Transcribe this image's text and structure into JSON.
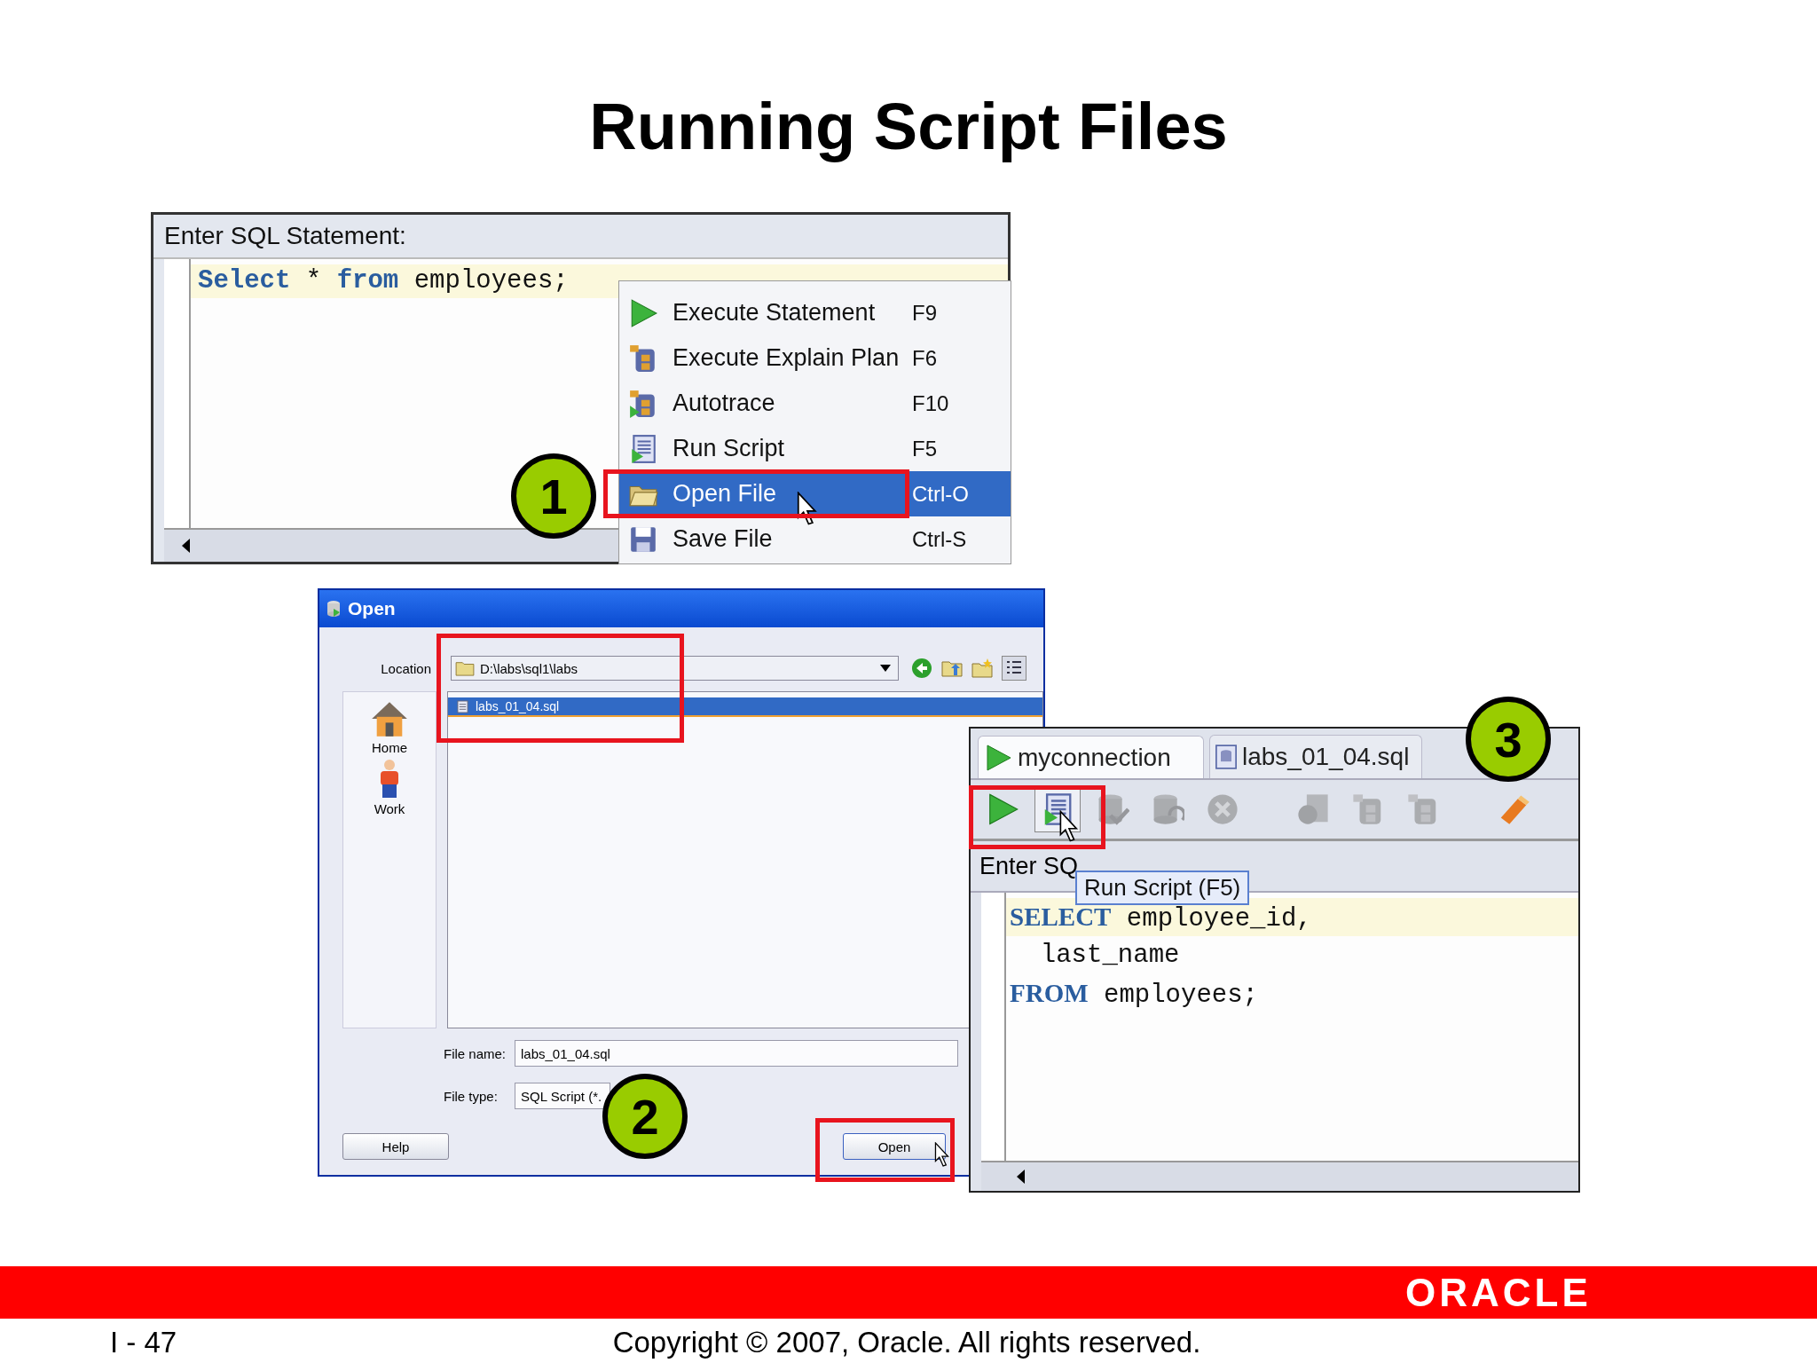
{
  "title": "Running Script Files",
  "worksheet_1": {
    "label": "Enter SQL Statement:",
    "code": [
      [
        {
          "kind": "keyword",
          "text": "Select"
        },
        {
          "kind": "plain",
          "text": " * "
        },
        {
          "kind": "keyword",
          "text": "from"
        },
        {
          "kind": "plain",
          "text": " employees;"
        }
      ]
    ],
    "context_menu": [
      {
        "kind": "execute",
        "label": "Execute Statement",
        "shortcut": "F9",
        "selected": false
      },
      {
        "kind": "explain",
        "label": "Execute Explain Plan",
        "shortcut": "F6",
        "selected": false
      },
      {
        "kind": "autotrace",
        "label": "Autotrace",
        "shortcut": "F10",
        "selected": false
      },
      {
        "kind": "run_script",
        "label": "Run Script",
        "shortcut": "F5",
        "selected": false
      },
      {
        "kind": "open",
        "label": "Open File",
        "shortcut": "Ctrl-O",
        "selected": true
      },
      {
        "kind": "save",
        "label": "Save File",
        "shortcut": "Ctrl-S",
        "selected": false
      }
    ]
  },
  "open_dialog": {
    "title": "Open",
    "location_label": "Location",
    "location": "D:\\labs\\sql1\\labs",
    "places": [
      {
        "kind": "home",
        "label": "Home"
      },
      {
        "kind": "user",
        "label": "Work"
      }
    ],
    "files": [
      {
        "name": "labs_01_04.sql",
        "selected": true
      }
    ],
    "file_name_label": "File name:",
    "file_name": "labs_01_04.sql",
    "file_type_label": "File type:",
    "file_type": "SQL Script (*.",
    "buttons": [
      "Help",
      "Open"
    ]
  },
  "worksheet_2": {
    "tabs": [
      {
        "label": "myconnection",
        "kind": "connection",
        "selected": true
      },
      {
        "label": "labs_01_04.sql",
        "kind": "file",
        "selected": false
      }
    ],
    "toolbar": [
      {
        "kind": "execute",
        "disabled": false,
        "selected": false
      },
      {
        "kind": "run_script",
        "disabled": false,
        "selected": true
      },
      {
        "kind": "commit",
        "disabled": true,
        "selected": false
      },
      {
        "kind": "rollback",
        "disabled": true,
        "selected": false
      },
      {
        "kind": "cancel",
        "disabled": true,
        "selected": false
      },
      {
        "kind": "history",
        "disabled": true,
        "selected": false
      },
      {
        "kind": "explain",
        "disabled": true,
        "selected": false
      },
      {
        "kind": "autotrace",
        "disabled": true,
        "selected": false
      },
      {
        "kind": "clear",
        "disabled": false,
        "selected": false
      }
    ],
    "label": "Enter SQ",
    "tooltip": "Run Script (F5)",
    "code": [
      [
        {
          "kind": "keyword",
          "text": "SELECT"
        },
        {
          "kind": "plain",
          "text": " employee_id,"
        }
      ],
      [
        {
          "kind": "plain",
          "text": "  last_name"
        }
      ],
      [
        {
          "kind": "keyword",
          "text": "FROM"
        },
        {
          "kind": "plain",
          "text": " employees;"
        }
      ]
    ]
  },
  "step_markers": [
    "1",
    "2",
    "3"
  ],
  "footer": {
    "page": "I - 47",
    "copyright": "Copyright © 2007, Oracle. All rights reserved.",
    "logo": "ORACLE"
  }
}
